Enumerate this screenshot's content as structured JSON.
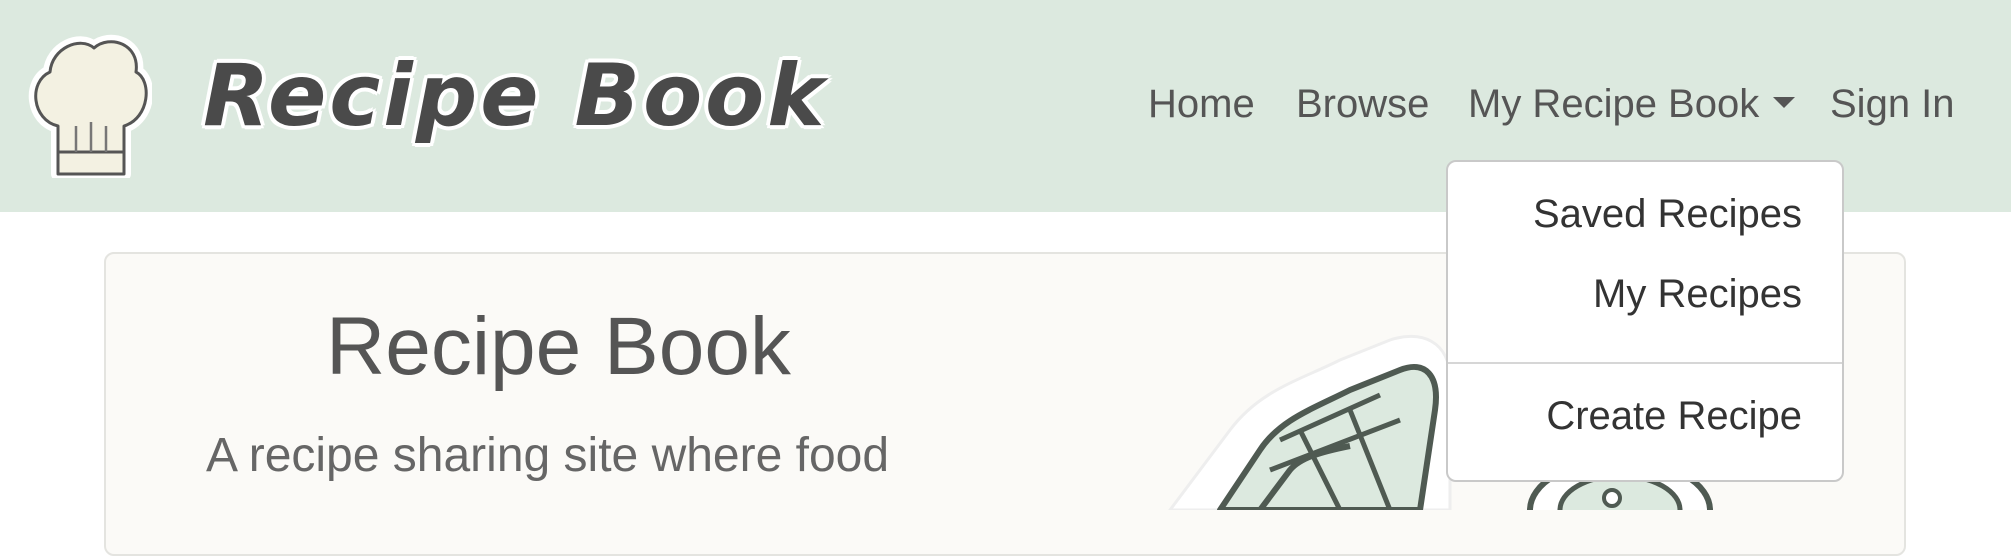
{
  "brand": {
    "name": "Recipe Book",
    "logo_icon": "chef-hat-icon"
  },
  "nav": {
    "home": "Home",
    "browse": "Browse",
    "my_recipe_book": "My Recipe Book",
    "sign_in": "Sign In"
  },
  "dropdown": {
    "items": [
      "Saved Recipes",
      "My Recipes",
      "Create Recipe"
    ]
  },
  "hero": {
    "title": "Recipe Book",
    "subtitle": "A recipe sharing site where food",
    "illustration_icon": "oven-mitt-icon"
  },
  "colors": {
    "navbar_bg": "#dce9df",
    "hero_bg": "#fbfaf7",
    "text": "#555555"
  }
}
